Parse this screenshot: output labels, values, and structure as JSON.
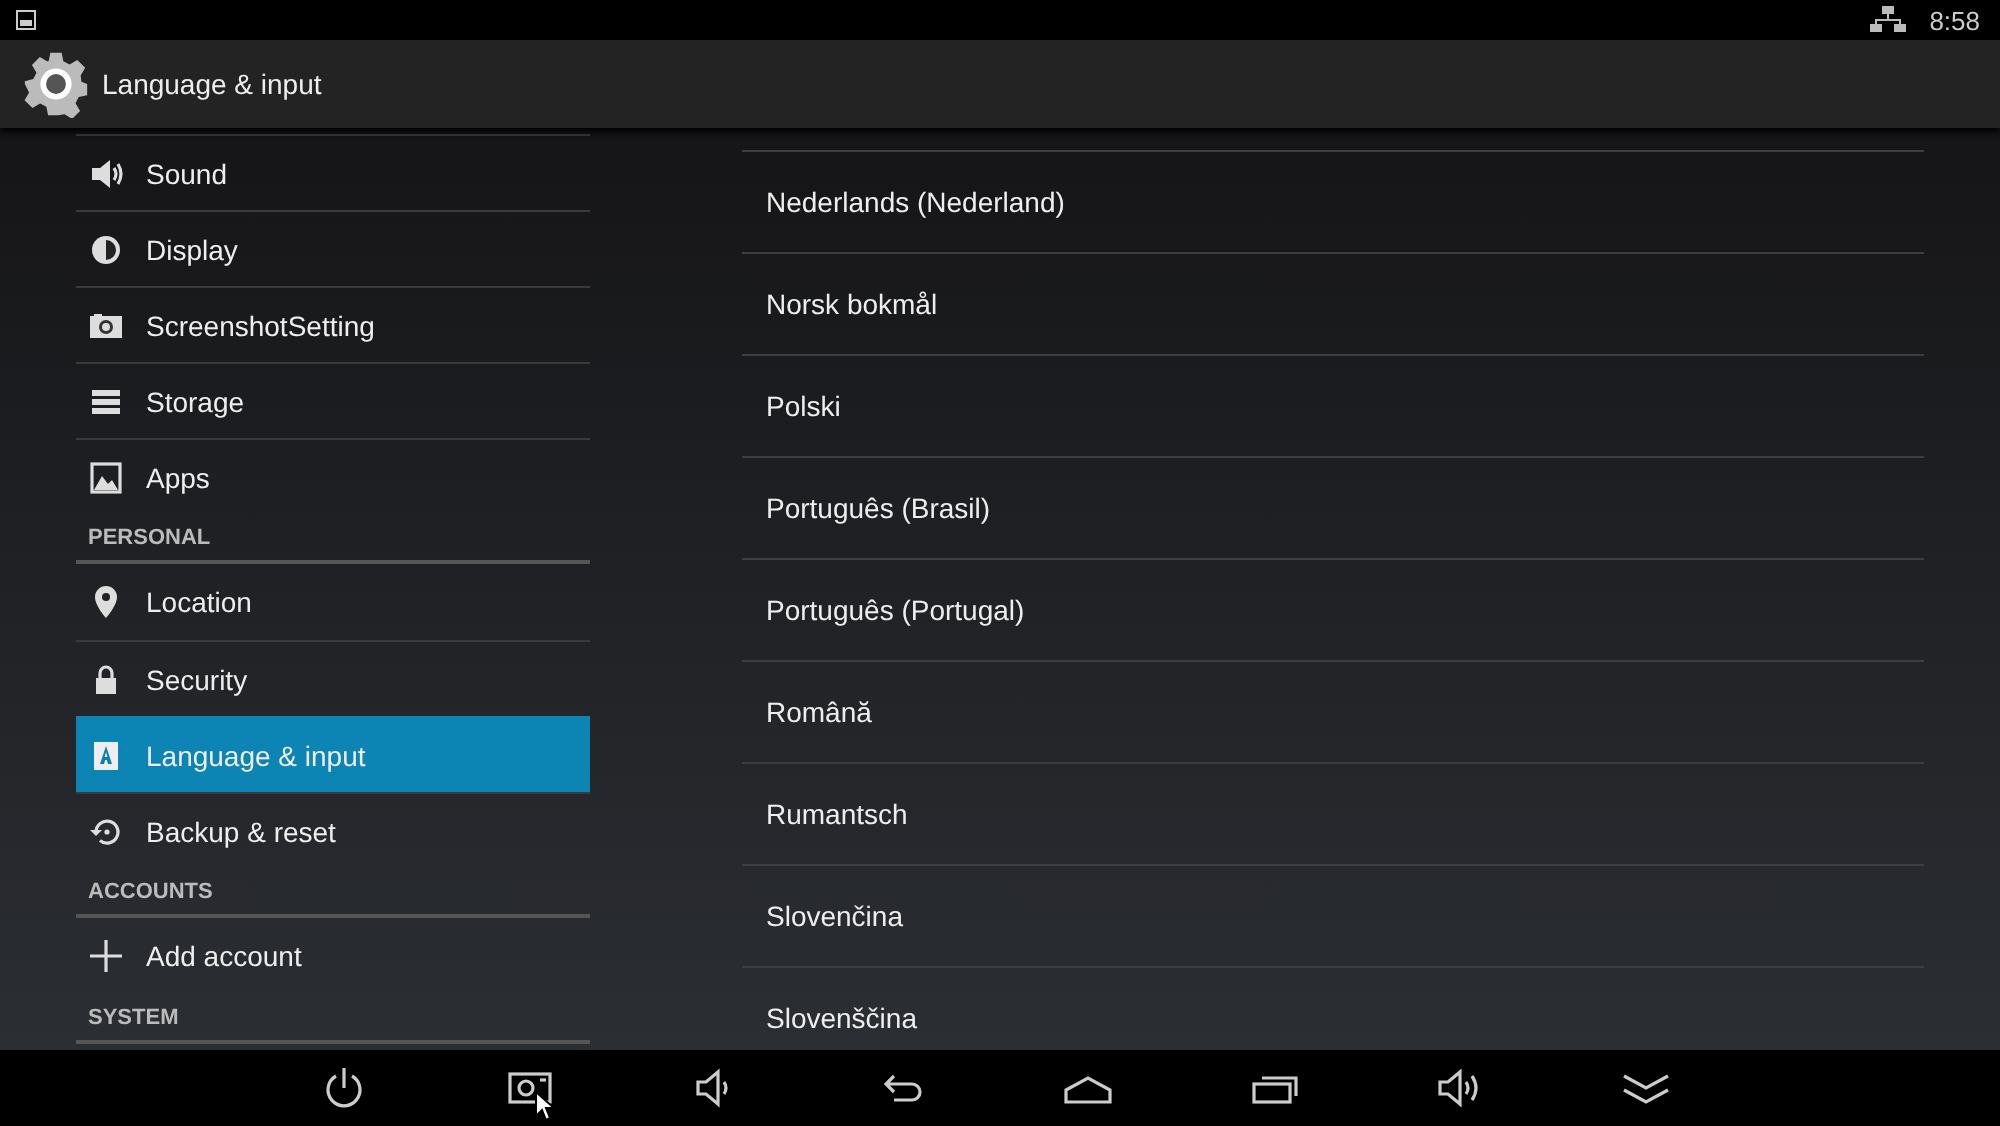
{
  "status_bar": {
    "time": "8:58"
  },
  "action_bar": {
    "title": "Language & input"
  },
  "sidebar": {
    "items": [
      {
        "kind": "item",
        "label": "Sound",
        "selected": false
      },
      {
        "kind": "item",
        "label": "Display",
        "selected": false
      },
      {
        "kind": "item",
        "label": "ScreenshotSetting",
        "selected": false
      },
      {
        "kind": "item",
        "label": "Storage",
        "selected": false
      },
      {
        "kind": "item",
        "label": "Apps",
        "selected": false
      },
      {
        "kind": "header",
        "label": "PERSONAL"
      },
      {
        "kind": "item",
        "label": "Location",
        "selected": false
      },
      {
        "kind": "item",
        "label": "Security",
        "selected": false
      },
      {
        "kind": "item",
        "label": "Language & input",
        "selected": true
      },
      {
        "kind": "item",
        "label": "Backup & reset",
        "selected": false
      },
      {
        "kind": "header",
        "label": "ACCOUNTS"
      },
      {
        "kind": "item",
        "label": "Add account",
        "selected": false
      },
      {
        "kind": "header",
        "label": "SYSTEM"
      }
    ]
  },
  "languages": [
    "Nederlands (Nederland)",
    "Norsk bokmål",
    "Polski",
    "Português (Brasil)",
    "Português (Portugal)",
    "Română",
    "Rumantsch",
    "Slovenčina",
    "Slovenščina"
  ]
}
